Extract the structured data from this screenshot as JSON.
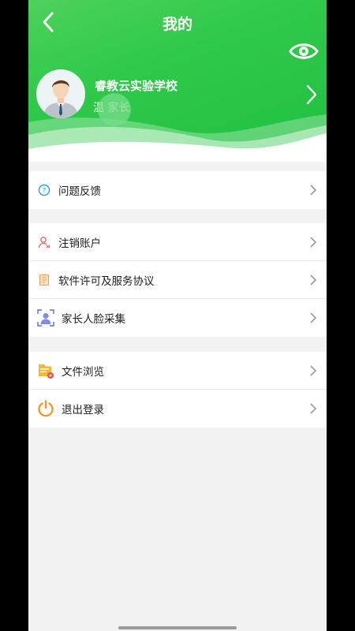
{
  "header": {
    "title": "我的",
    "school": "睿教云实验学校",
    "role": "温 家长",
    "bg_color": "#2fc94a"
  },
  "menu_groups": [
    {
      "items": [
        {
          "label": "问题反馈",
          "icon": "question-circle-icon"
        }
      ]
    },
    {
      "items": [
        {
          "label": "注销账户",
          "icon": "user-remove-icon"
        },
        {
          "label": "软件许可及服务协议",
          "icon": "document-icon"
        },
        {
          "label": "家长人脸采集",
          "icon": "face-capture-icon"
        }
      ]
    },
    {
      "items": [
        {
          "label": "文件浏览",
          "icon": "folder-icon"
        },
        {
          "label": "退出登录",
          "icon": "power-icon"
        }
      ]
    }
  ]
}
